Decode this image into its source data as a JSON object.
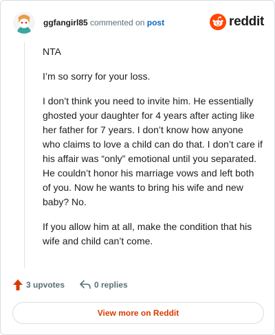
{
  "header": {
    "username": "ggfangirl85",
    "action_text": " commented on ",
    "post_link": "post",
    "brand_word": "reddit"
  },
  "comment": {
    "paragraphs": [
      "NTA",
      "I’m so sorry for your loss.",
      "I don’t think you need to invite him. He essentially ghosted your daughter for 4 years after acting like her father for 7 years. I don’t know how anyone who claims to love a child can do that. I don’t care if his affair was “only” emotional until you separated. He couldn’t honor his marriage vows and left both of you. Now he wants to bring his wife and new baby? No.",
      "If you allow him at all, make the condition that his wife and child can’t come."
    ]
  },
  "actions": {
    "upvotes": "3 upvotes",
    "replies": "0 replies"
  },
  "footer": {
    "view_more": "View more on Reddit"
  },
  "colors": {
    "brand_orange": "#ff4500",
    "upvote_orange": "#d93a00",
    "link_blue": "#0b66c2"
  },
  "icons": {
    "avatar": "snoo-avatar-icon",
    "logo": "reddit-logo-icon",
    "upvote": "upvote-arrow-icon",
    "reply": "reply-arrow-icon"
  }
}
